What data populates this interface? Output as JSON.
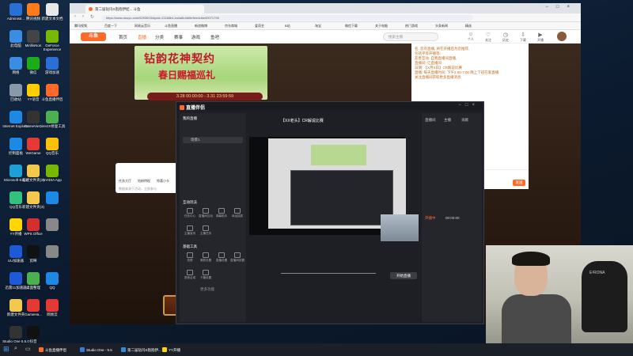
{
  "desktop": {
    "icons": [
      {
        "label": "Administr...",
        "color": "#2a6fd6"
      },
      {
        "label": "腾讯视频",
        "color": "#ff7a1a"
      },
      {
        "label": "新建文本文档",
        "color": "#e8e8e8"
      },
      {
        "label": "此电脑",
        "color": "#3a8de0"
      },
      {
        "label": "MirillisNon",
        "color": "#444"
      },
      {
        "label": "GeForce Experience",
        "color": "#76b900"
      },
      {
        "label": "网络",
        "color": "#3a8de0"
      },
      {
        "label": "微信",
        "color": "#1aad19"
      },
      {
        "label": "游戏加速",
        "color": "#2a6fd6"
      },
      {
        "label": "回收站",
        "color": "#8899aa"
      },
      {
        "label": "YY语音",
        "color": "#ffcc00"
      },
      {
        "label": "斗鱼直播伴侣",
        "color": "#ff6a2a"
      },
      {
        "label": "Internet Explorer",
        "color": "#1e88e5"
      },
      {
        "label": "GameVie...",
        "color": "#333"
      },
      {
        "label": "DirectX修复工具",
        "color": "#4caf50"
      },
      {
        "label": "控制面板",
        "color": "#1e88e5"
      },
      {
        "label": "WeGame",
        "color": "#e53935"
      },
      {
        "label": "QQ音乐",
        "color": "#ffc107"
      },
      {
        "label": "Microsoft Edge",
        "color": "#1e9fd8"
      },
      {
        "label": "新建文件夹(2)",
        "color": "#f2c94c"
      },
      {
        "label": "NVIDIA App",
        "color": "#76b900"
      },
      {
        "label": "QQ音乐",
        "color": "#31c27c"
      },
      {
        "label": "新建文件夹(3)",
        "color": "#f2c94c"
      },
      {
        "label": "",
        "color": "#1e88e5"
      },
      {
        "label": "YY开播",
        "color": "#ffd600"
      },
      {
        "label": "WPS Office",
        "color": "#d32f2f"
      },
      {
        "label": "",
        "color": "#888"
      },
      {
        "label": "UU加速器",
        "color": "#1e5ad6"
      },
      {
        "label": "剪映",
        "color": "#111"
      },
      {
        "label": "",
        "color": "#888"
      },
      {
        "label": "迅雷11加速器",
        "color": "#1e5ad6"
      },
      {
        "label": "桌面整理",
        "color": "#4caf50"
      },
      {
        "label": "QQ",
        "color": "#1e88e5"
      },
      {
        "label": "新建文件夹",
        "color": "#f2c94c"
      },
      {
        "label": "GameHa...",
        "color": "#e53935"
      },
      {
        "label": "网易云",
        "color": "#e53935"
      },
      {
        "label": "Studio One 5.5.0",
        "color": "#333"
      },
      {
        "label": "抖音",
        "color": "#111"
      }
    ]
  },
  "browser": {
    "tab_title": "第二届钻玛X抱抱伊娃... 斗鱼",
    "url": "https://www.douyu.com/5253503/dycid=21168bt-1a4a6b4fd5e5ee4dbe00071795",
    "bookmarks": [
      "腾讯视频",
      "百度一下",
      "网易云音乐",
      "斗鱼直播",
      "新浪微博",
      "京东商城",
      "爱奇艺",
      "B站",
      "淘宝",
      "微信下载",
      "关于电脑",
      "热门游戏",
      "头条新闻",
      "精选"
    ]
  },
  "site": {
    "logo": "斗鱼",
    "nav": [
      "首页",
      "直播",
      "分类",
      "赛事",
      "游戏",
      "鱼吧"
    ],
    "search_placeholder": "搜索主播",
    "header_icons": [
      {
        "label": "个人",
        "icon": "☺"
      },
      {
        "label": "关注",
        "icon": "♡"
      },
      {
        "label": "历史",
        "icon": "◷"
      },
      {
        "label": "下载",
        "icon": "⇩"
      },
      {
        "label": "开播",
        "icon": "▶"
      }
    ]
  },
  "banner": {
    "title": "钻韵花神契约",
    "subtitle": "春日赐福巡礼",
    "date_range": "3.28 00:00:00 - 3.31 23:59:59"
  },
  "room_info": {
    "lines": [
      "名, 您的直播, 将在开播后为您推荐,",
      "包括平等开播等,",
      "友善互动. 自我直播间直播,",
      "直播间: 亿直播间",
      "日期: 【X月X日】CR解说比赛",
      "直播: 每天直播时间: 下午2:00-7:00 晚上下班在家直播",
      "关注直播间获取更多直播消息"
    ],
    "send_label": "发送"
  },
  "giftbar": {
    "items": [
      "任务大厅",
      "钻粉特权",
      "惊喜小卡"
    ],
    "hint": "数据来源于活动，立即参与"
  },
  "weekdays": [
    "周一",
    "周二",
    "周三",
    "周四",
    "周五",
    "周六",
    "周日"
  ],
  "app": {
    "title": "直播伴侣",
    "left_header": "我的直播",
    "scene_label": "场景1",
    "section_interact": "互动玩法",
    "section_tools": "基础工具",
    "tools_a": [
      "任务中心",
      "直播间互动",
      "弹幕助手",
      "幸运抽奖",
      "主播宣传",
      "主播任务"
    ],
    "tools_b": [
      "录屏",
      "美颜设置",
      "直播设置",
      "直播间设置",
      "语音合成",
      "下播设置"
    ],
    "more": "更多功能",
    "stream_title": "【XX老头】CR解说比赛",
    "start_button": "开始直播",
    "right_tabs": [
      "直播间",
      "主播",
      "贡献"
    ],
    "status": [
      "开播中",
      "00:00:00"
    ]
  },
  "webcam": {
    "chair_text": "E²RONA"
  },
  "taskbar": {
    "items": [
      {
        "label": "斗鱼直播伴侣",
        "color": "#ff6a2a"
      },
      {
        "label": "Studio One - 5.5",
        "color": "#3a7bd5"
      },
      {
        "label": "第二届钻玛X抱抱伊... ",
        "color": "#2a8de0"
      },
      {
        "label": "YY开播",
        "color": "#ffd600"
      }
    ]
  }
}
